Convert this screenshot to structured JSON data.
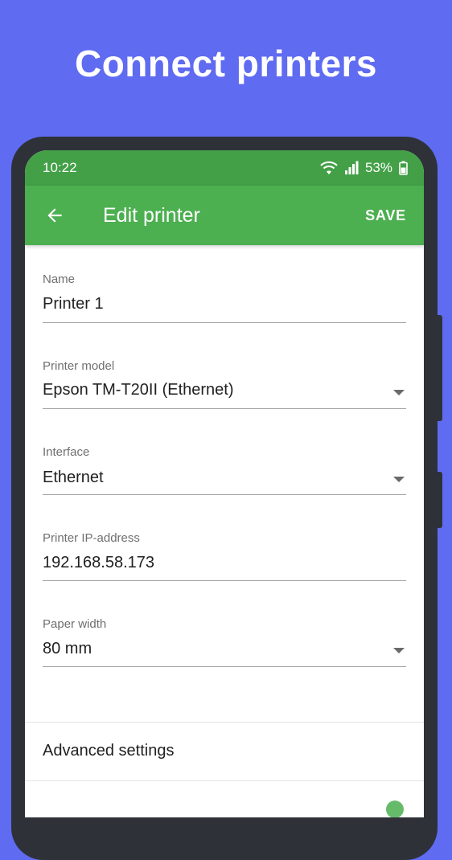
{
  "headline": "Connect printers",
  "status": {
    "time": "10:22",
    "battery": "53%"
  },
  "appbar": {
    "title": "Edit printer",
    "save_label": "SAVE"
  },
  "fields": {
    "name": {
      "label": "Name",
      "value": "Printer 1"
    },
    "model": {
      "label": "Printer model",
      "value": "Epson TM-T20II (Ethernet)"
    },
    "interface": {
      "label": "Interface",
      "value": "Ethernet"
    },
    "ip": {
      "label": "Printer IP-address",
      "value": "192.168.58.173"
    },
    "paper": {
      "label": "Paper width",
      "value": "80 mm"
    }
  },
  "advanced": {
    "label": "Advanced settings"
  },
  "colors": {
    "background": "#5F6BF1",
    "statusbar": "#43A047",
    "appbar": "#4CAF50"
  },
  "icons": [
    "wifi-icon",
    "signal-icon",
    "battery-icon",
    "back-arrow-icon",
    "dropdown-arrow-icon"
  ]
}
